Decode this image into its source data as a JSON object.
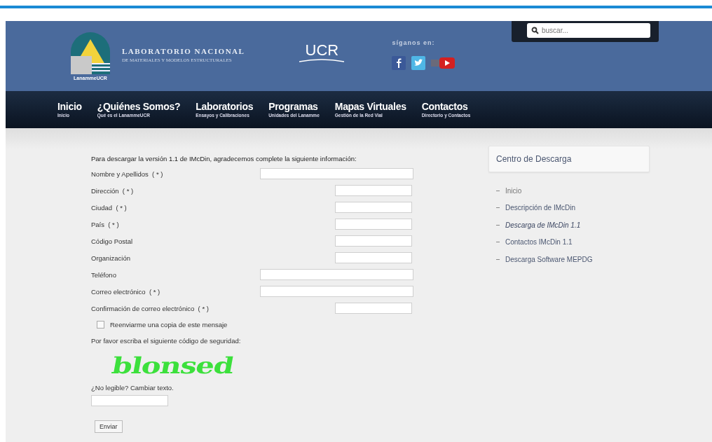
{
  "header": {
    "logo_caption": "LanammeUCR",
    "lab_name": "LABORATORIO NACIONAL",
    "lab_subtitle": "DE MATERIALES Y MODELOS ESTRUCTURALES",
    "university": "UCR",
    "follow_label": "síganos en:",
    "search": {
      "placeholder": "buscar..."
    }
  },
  "nav": [
    {
      "label": "Inicio",
      "sub": "Inicio"
    },
    {
      "label": "¿Quiénes Somos?",
      "sub": "Qué es el LanammeUCR"
    },
    {
      "label": "Laboratorios",
      "sub": "Ensayos y Calibraciones"
    },
    {
      "label": "Programas",
      "sub": "Unidades del Lanamme"
    },
    {
      "label": "Mapas Virtuales",
      "sub": "Gestión de la Red Vial"
    },
    {
      "label": "Contactos",
      "sub": "Directorio y Contactos"
    }
  ],
  "form": {
    "intro": "Para descargar la versión 1.1 de IMcDin, agradecemos complete la siguiente información:",
    "fields": [
      {
        "label": "Nombre y Apellidos  ( * )",
        "kind": "wide"
      },
      {
        "label": "Dirección  ( * )",
        "kind": "narrow"
      },
      {
        "label": "Ciudad  ( * )",
        "kind": "narrow"
      },
      {
        "label": "País  ( * )",
        "kind": "narrow"
      },
      {
        "label": "Código Postal",
        "kind": "narrow"
      },
      {
        "label": "Organización",
        "kind": "narrow"
      },
      {
        "label": "Teléfono",
        "kind": "wide"
      },
      {
        "label": "Correo electrónico  ( * )",
        "kind": "wide"
      },
      {
        "label": "Confirmación de correo electrónico  ( * )",
        "kind": "narrow"
      }
    ],
    "copy_checkbox": {
      "label": "Reenviarme una copia de este mensaje",
      "checked": false
    },
    "captcha_prompt": "Por favor escriba el siguiente código de seguridad:",
    "captcha": "blonsed",
    "refresh_link": "¿No legible? Cambiar texto.",
    "submit": "Enviar"
  },
  "sidebar": {
    "title": "Centro de Descarga",
    "items": [
      {
        "label": "Inicio",
        "selected": false
      },
      {
        "label": "Descripción de IMcDin",
        "selected": false
      },
      {
        "label": "Descarga de IMcDin 1.1",
        "selected": true
      },
      {
        "label": "Contactos IMcDin 1.1",
        "selected": false
      },
      {
        "label": "Descarga Software MEPDG",
        "selected": false
      }
    ]
  }
}
